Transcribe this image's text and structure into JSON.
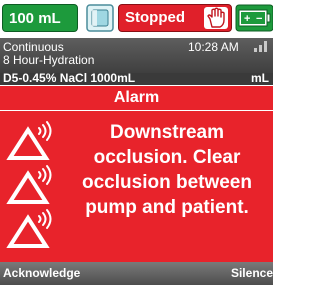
{
  "status_bar": {
    "volume": "100 mL",
    "bag_icon": "iv-bag-icon",
    "state": "Stopped",
    "hand_icon": "hand-stop-icon",
    "battery_icon": "battery-icon",
    "colors": {
      "volume_bg": "#1d9a3c",
      "state_bg": "#e0202a"
    }
  },
  "info": {
    "mode": "Continuous",
    "time": "10:28 AM",
    "signal_icon": "signal-icon",
    "therapy": "8 Hour-Hydration",
    "drug": "D5-0.45% NaCl 1000mL",
    "units": "mL"
  },
  "alarm": {
    "title": "Alarm",
    "message": "Downstream occlusion. Clear occlusion between pump and patient.",
    "icon": "audio-alarm-triangle-icon",
    "color": "#e8232b"
  },
  "softkeys": {
    "left": "Acknowledge",
    "right": "Silence"
  }
}
